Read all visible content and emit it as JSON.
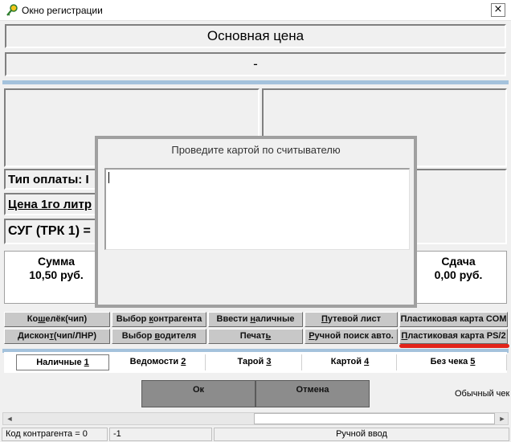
{
  "window": {
    "title": "Окно регистрации",
    "close_label": "×"
  },
  "header": {
    "price_title": "Основная цена",
    "price_value": "-"
  },
  "info": {
    "payment_type": "Тип оплаты:  I",
    "liter_price": "Цена 1го литр",
    "dispenser": "СУГ (ТРК 1) ="
  },
  "totals": {
    "sum_label": "Сумма",
    "sum_value": "10,50  руб.",
    "change_label": "Сдача",
    "change_value": "0,00  руб."
  },
  "dialog": {
    "prompt": "Проведите картой по считывателю",
    "input_value": ""
  },
  "buttons_row1": [
    {
      "pre": "Ко",
      "u": "ш",
      "post": "елёк(чип)"
    },
    {
      "pre": "Выбор ",
      "u": "к",
      "post": "онтрагента"
    },
    {
      "pre": "Ввести ",
      "u": "н",
      "post": "аличные"
    },
    {
      "pre": "",
      "u": "П",
      "post": "утевой лист"
    },
    {
      "pre": "Пластиковая карта COM",
      "u": "",
      "post": ""
    }
  ],
  "buttons_row2": [
    {
      "pre": "Дискон",
      "u": "т",
      "post": "(чип/ЛНР)"
    },
    {
      "pre": "Выбор ",
      "u": "в",
      "post": "одителя"
    },
    {
      "pre": "Печат",
      "u": "ь",
      "post": ""
    },
    {
      "pre": "",
      "u": "Р",
      "post": "учной поиск авто."
    },
    {
      "pre": "",
      "u": "П",
      "post": "ластиковая карта PS/2"
    }
  ],
  "tabs": [
    {
      "pre": "Наличные ",
      "u": "1"
    },
    {
      "pre": "Ведомости ",
      "u": "2"
    },
    {
      "pre": "Тарой ",
      "u": "3"
    },
    {
      "pre": "Картой ",
      "u": "4"
    },
    {
      "pre": "Без чека ",
      "u": "5"
    }
  ],
  "actions": {
    "ok": "Ок",
    "cancel": "Отмена",
    "receipt_mode": "Обычный чек"
  },
  "scrollbar": {
    "left": "◄",
    "right": "►"
  },
  "status": {
    "counterparty_code": "Код контрагента = 0",
    "value": "-1",
    "mode": "Ручной ввод"
  },
  "colors": {
    "annotation_underline": "#e2231a",
    "separator": "#a4c2dc"
  }
}
